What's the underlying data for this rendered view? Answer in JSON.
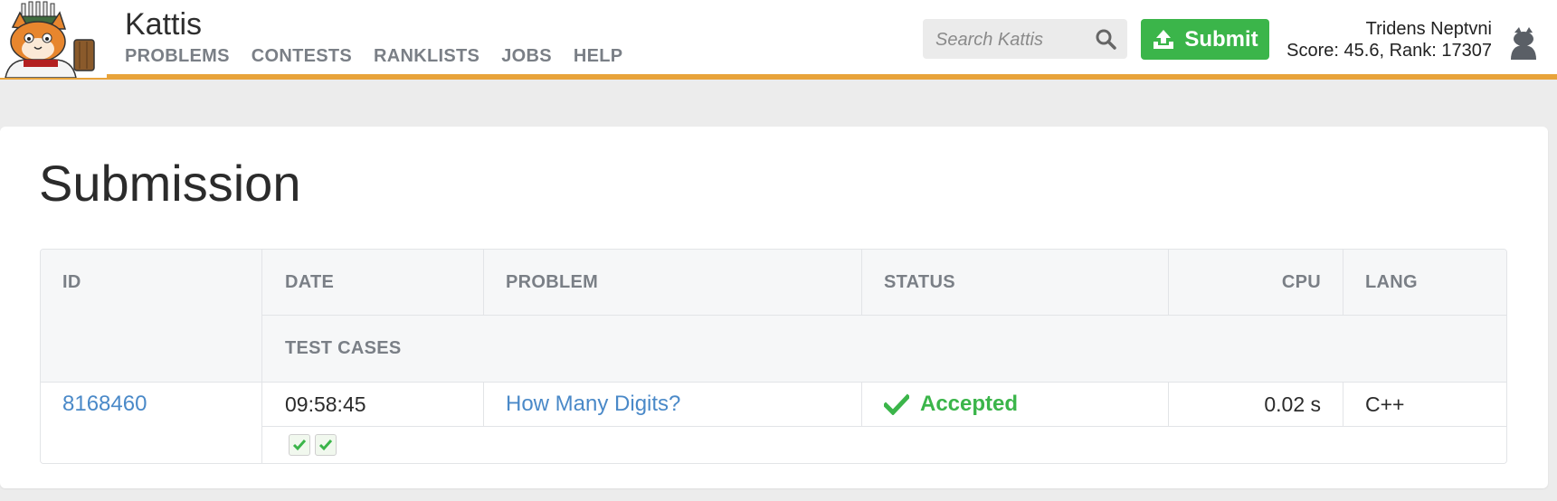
{
  "header": {
    "brand": "Kattis",
    "nav": [
      "PROBLEMS",
      "CONTESTS",
      "RANKLISTS",
      "JOBS",
      "HELP"
    ],
    "search_placeholder": "Search Kattis",
    "submit_label": "Submit",
    "user_name": "Tridens Neptvni",
    "user_stats": "Score: 45.6, Rank: 17307",
    "accent_color": "#e8a33a",
    "submit_color": "#3bb54a"
  },
  "page": {
    "title": "Submission"
  },
  "table": {
    "headers": [
      "ID",
      "DATE",
      "PROBLEM",
      "STATUS",
      "CPU",
      "LANG"
    ],
    "subheader": "TEST CASES",
    "row": {
      "id": "8168460",
      "date": "09:58:45",
      "problem": "How Many Digits?",
      "status": "Accepted",
      "cpu": "0.02 s",
      "lang": "C++"
    },
    "test_cases": [
      "passed",
      "passed"
    ],
    "status_color": "#3bb54a",
    "link_color": "#4a89c8"
  }
}
